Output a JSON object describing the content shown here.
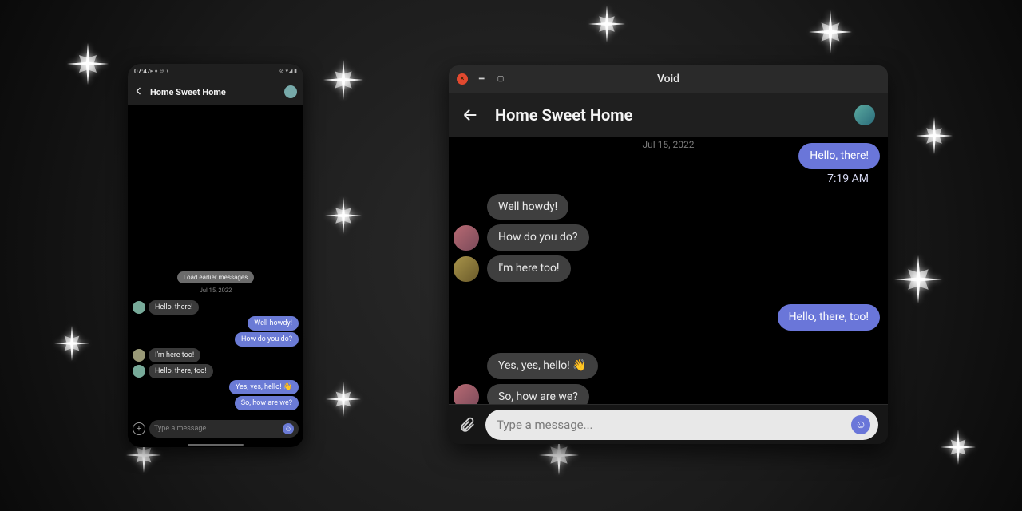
{
  "window": {
    "title": "Void",
    "controls": {
      "close": "×",
      "min": "−",
      "max": "▢"
    }
  },
  "chat": {
    "title": "Home Sweet Home",
    "load_earlier": "Load earlier messages",
    "date_label": "Jul 15, 2022",
    "compose": {
      "placeholder": "Type a message...",
      "plus": "+",
      "attach": "📎",
      "smile": "☺"
    }
  },
  "phone": {
    "status": {
      "time": "07:47",
      "left_icons": "▸ ● ⊖ ◑",
      "right_icons": "⊘ ▾◢ ▮"
    },
    "messages": [
      {
        "dir": "recv",
        "text": "Hello, there!",
        "avatar": "a"
      },
      {
        "dir": "send",
        "text": "Well howdy!"
      },
      {
        "dir": "send",
        "text": "How do you do?"
      },
      {
        "dir": "recv",
        "text": "I'm here too!",
        "avatar": "b"
      },
      {
        "dir": "recv",
        "text": "Hello, there, too!",
        "avatar": "a"
      },
      {
        "dir": "send",
        "text": "Yes, yes, hello! 👋"
      },
      {
        "dir": "send",
        "text": "So, how are we?"
      }
    ]
  },
  "desktop": {
    "messages": [
      {
        "dir": "send",
        "text": "Hello, there!"
      },
      {
        "dir": "send",
        "text": "7:19 AM",
        "timeonly": true
      },
      {
        "dir": "recv",
        "text": "Well howdy!"
      },
      {
        "dir": "recv",
        "text": "How do you do?",
        "avatar": "a"
      },
      {
        "dir": "recv",
        "text": "I'm here too!",
        "avatar": "b"
      },
      {
        "spacer": true
      },
      {
        "dir": "send",
        "text": "Hello, there, too!"
      },
      {
        "spacer": true
      },
      {
        "dir": "recv",
        "text": "Yes, yes, hello! 👋"
      },
      {
        "dir": "recv",
        "text": "So, how are we?",
        "avatar": "a"
      }
    ]
  }
}
